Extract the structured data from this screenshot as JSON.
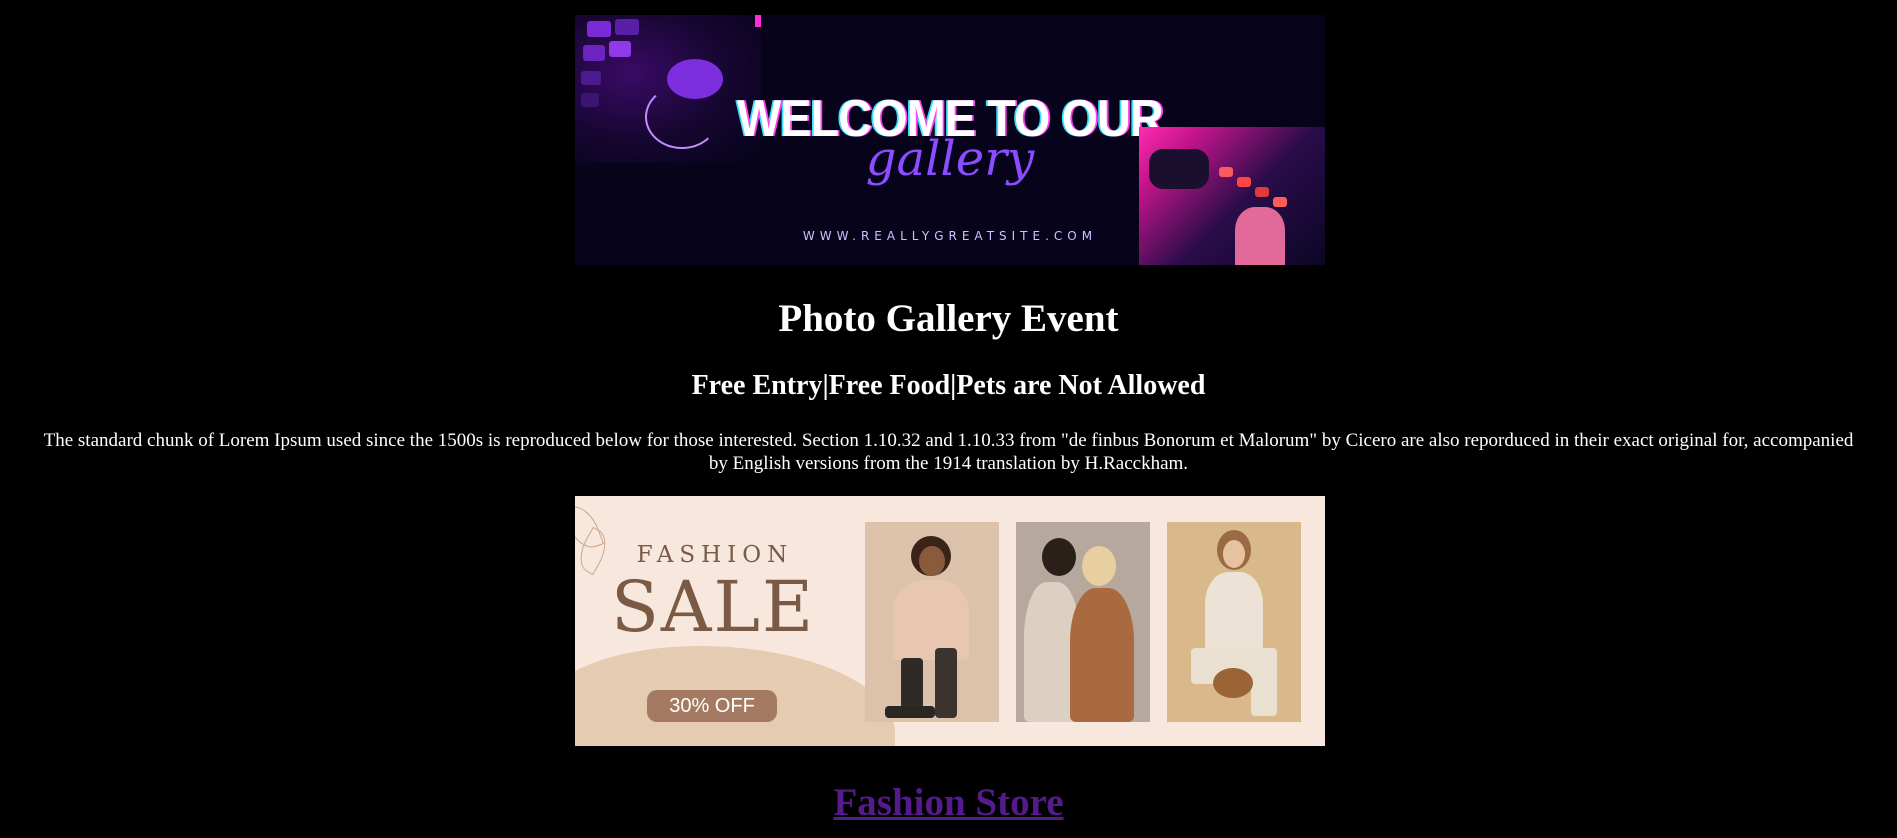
{
  "banner_top": {
    "headline": "WELCOME TO OUR",
    "script": "gallery",
    "url": "WWW.REALLYGREATSITE.COM"
  },
  "event": {
    "title": "Photo Gallery Event",
    "subtitle": "Free Entry|Free Food|Pets are Not Allowed",
    "description": "The standard chunk of Lorem Ipsum used since the 1500s is reproduced below for those interested. Section 1.10.32 and 1.10.33 from \"de finbus Bonorum et Malorum\" by Cicero are also reporduced in their exact original for, accompanied by English versions from the 1914 translation by H.Racckham."
  },
  "banner_sale": {
    "fashion": "FASHION",
    "sale": "SALE",
    "badge": "30% OFF"
  },
  "link": {
    "label": "Fashion Store"
  },
  "colors": {
    "background": "#000000",
    "text": "#ffffff",
    "link": "#551a8b",
    "sale_background": "#f7e7dc",
    "sale_text": "#7a5a45"
  }
}
